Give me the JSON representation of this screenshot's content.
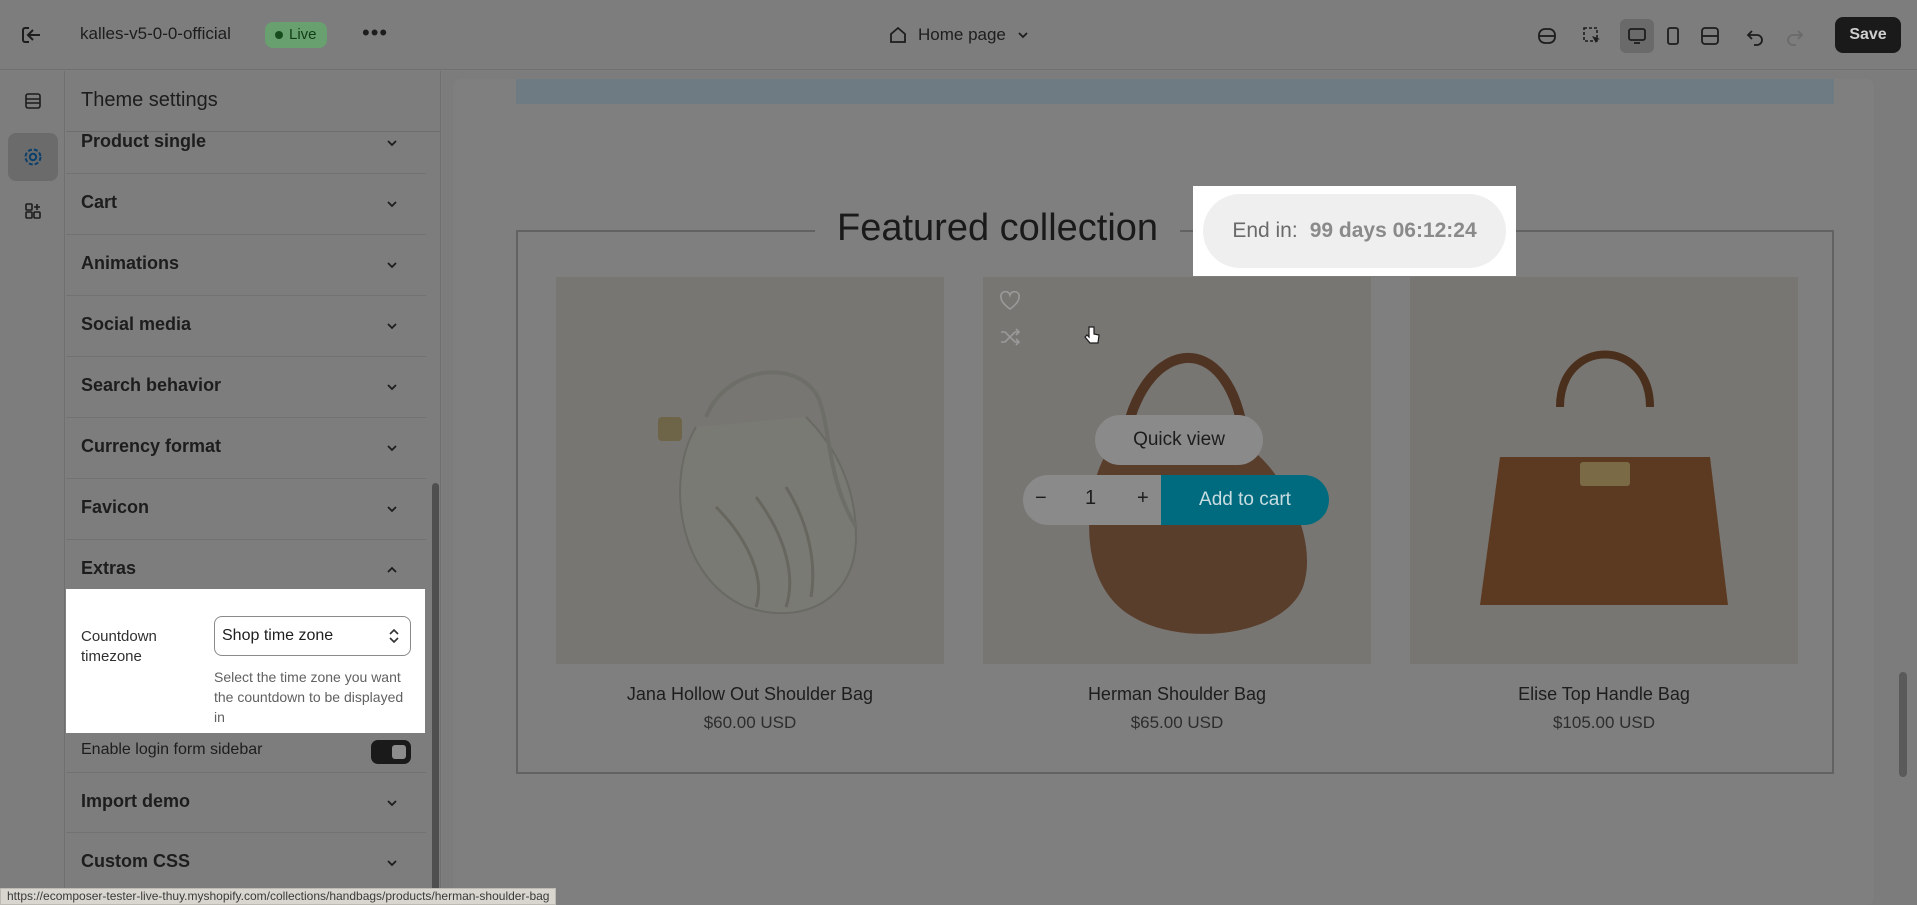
{
  "topbar": {
    "store_name": "kalles-v5-0-0-official",
    "status_badge": "Live",
    "page_selector": "Home page",
    "save_label": "Save"
  },
  "sidebar": {
    "title": "Theme settings",
    "sections": [
      {
        "label": "Product single",
        "expanded": false
      },
      {
        "label": "Cart",
        "expanded": false
      },
      {
        "label": "Animations",
        "expanded": false
      },
      {
        "label": "Social media",
        "expanded": false
      },
      {
        "label": "Search behavior",
        "expanded": false
      },
      {
        "label": "Currency format",
        "expanded": false
      },
      {
        "label": "Favicon",
        "expanded": false
      },
      {
        "label": "Extras",
        "expanded": true
      },
      {
        "label": "Import demo",
        "expanded": false
      },
      {
        "label": "Custom CSS",
        "expanded": false
      }
    ],
    "extras": {
      "countdown_label": "Countdown timezone",
      "countdown_value": "Shop time zone",
      "countdown_help": "Select the time zone you want the countdown to be displayed in",
      "login_label": "Enable login form sidebar",
      "login_enabled": true
    }
  },
  "preview": {
    "collection_title": "Featured collection",
    "countdown_label": "End in:",
    "countdown_value": "99 days 06:12:24",
    "quick_view_label": "Quick view",
    "add_to_cart_label": "Add to cart",
    "quantity_value": "1",
    "qty_minus": "−",
    "qty_plus": "+",
    "products": [
      {
        "name": "Jana Hollow Out Shoulder Bag",
        "price": "$60.00 USD"
      },
      {
        "name": "Herman Shoulder Bag",
        "price": "$65.00 USD"
      },
      {
        "name": "Elise Top Handle Bag",
        "price": "$105.00 USD"
      }
    ]
  },
  "status_url": "https://ecomposer-tester-live-thuy.myshopify.com/collections/handbags/products/herman-shoulder-bag",
  "colors": {
    "accent_teal": "#006b7f",
    "live_green": "#68a06f",
    "save_dark": "#1a1a1a"
  }
}
